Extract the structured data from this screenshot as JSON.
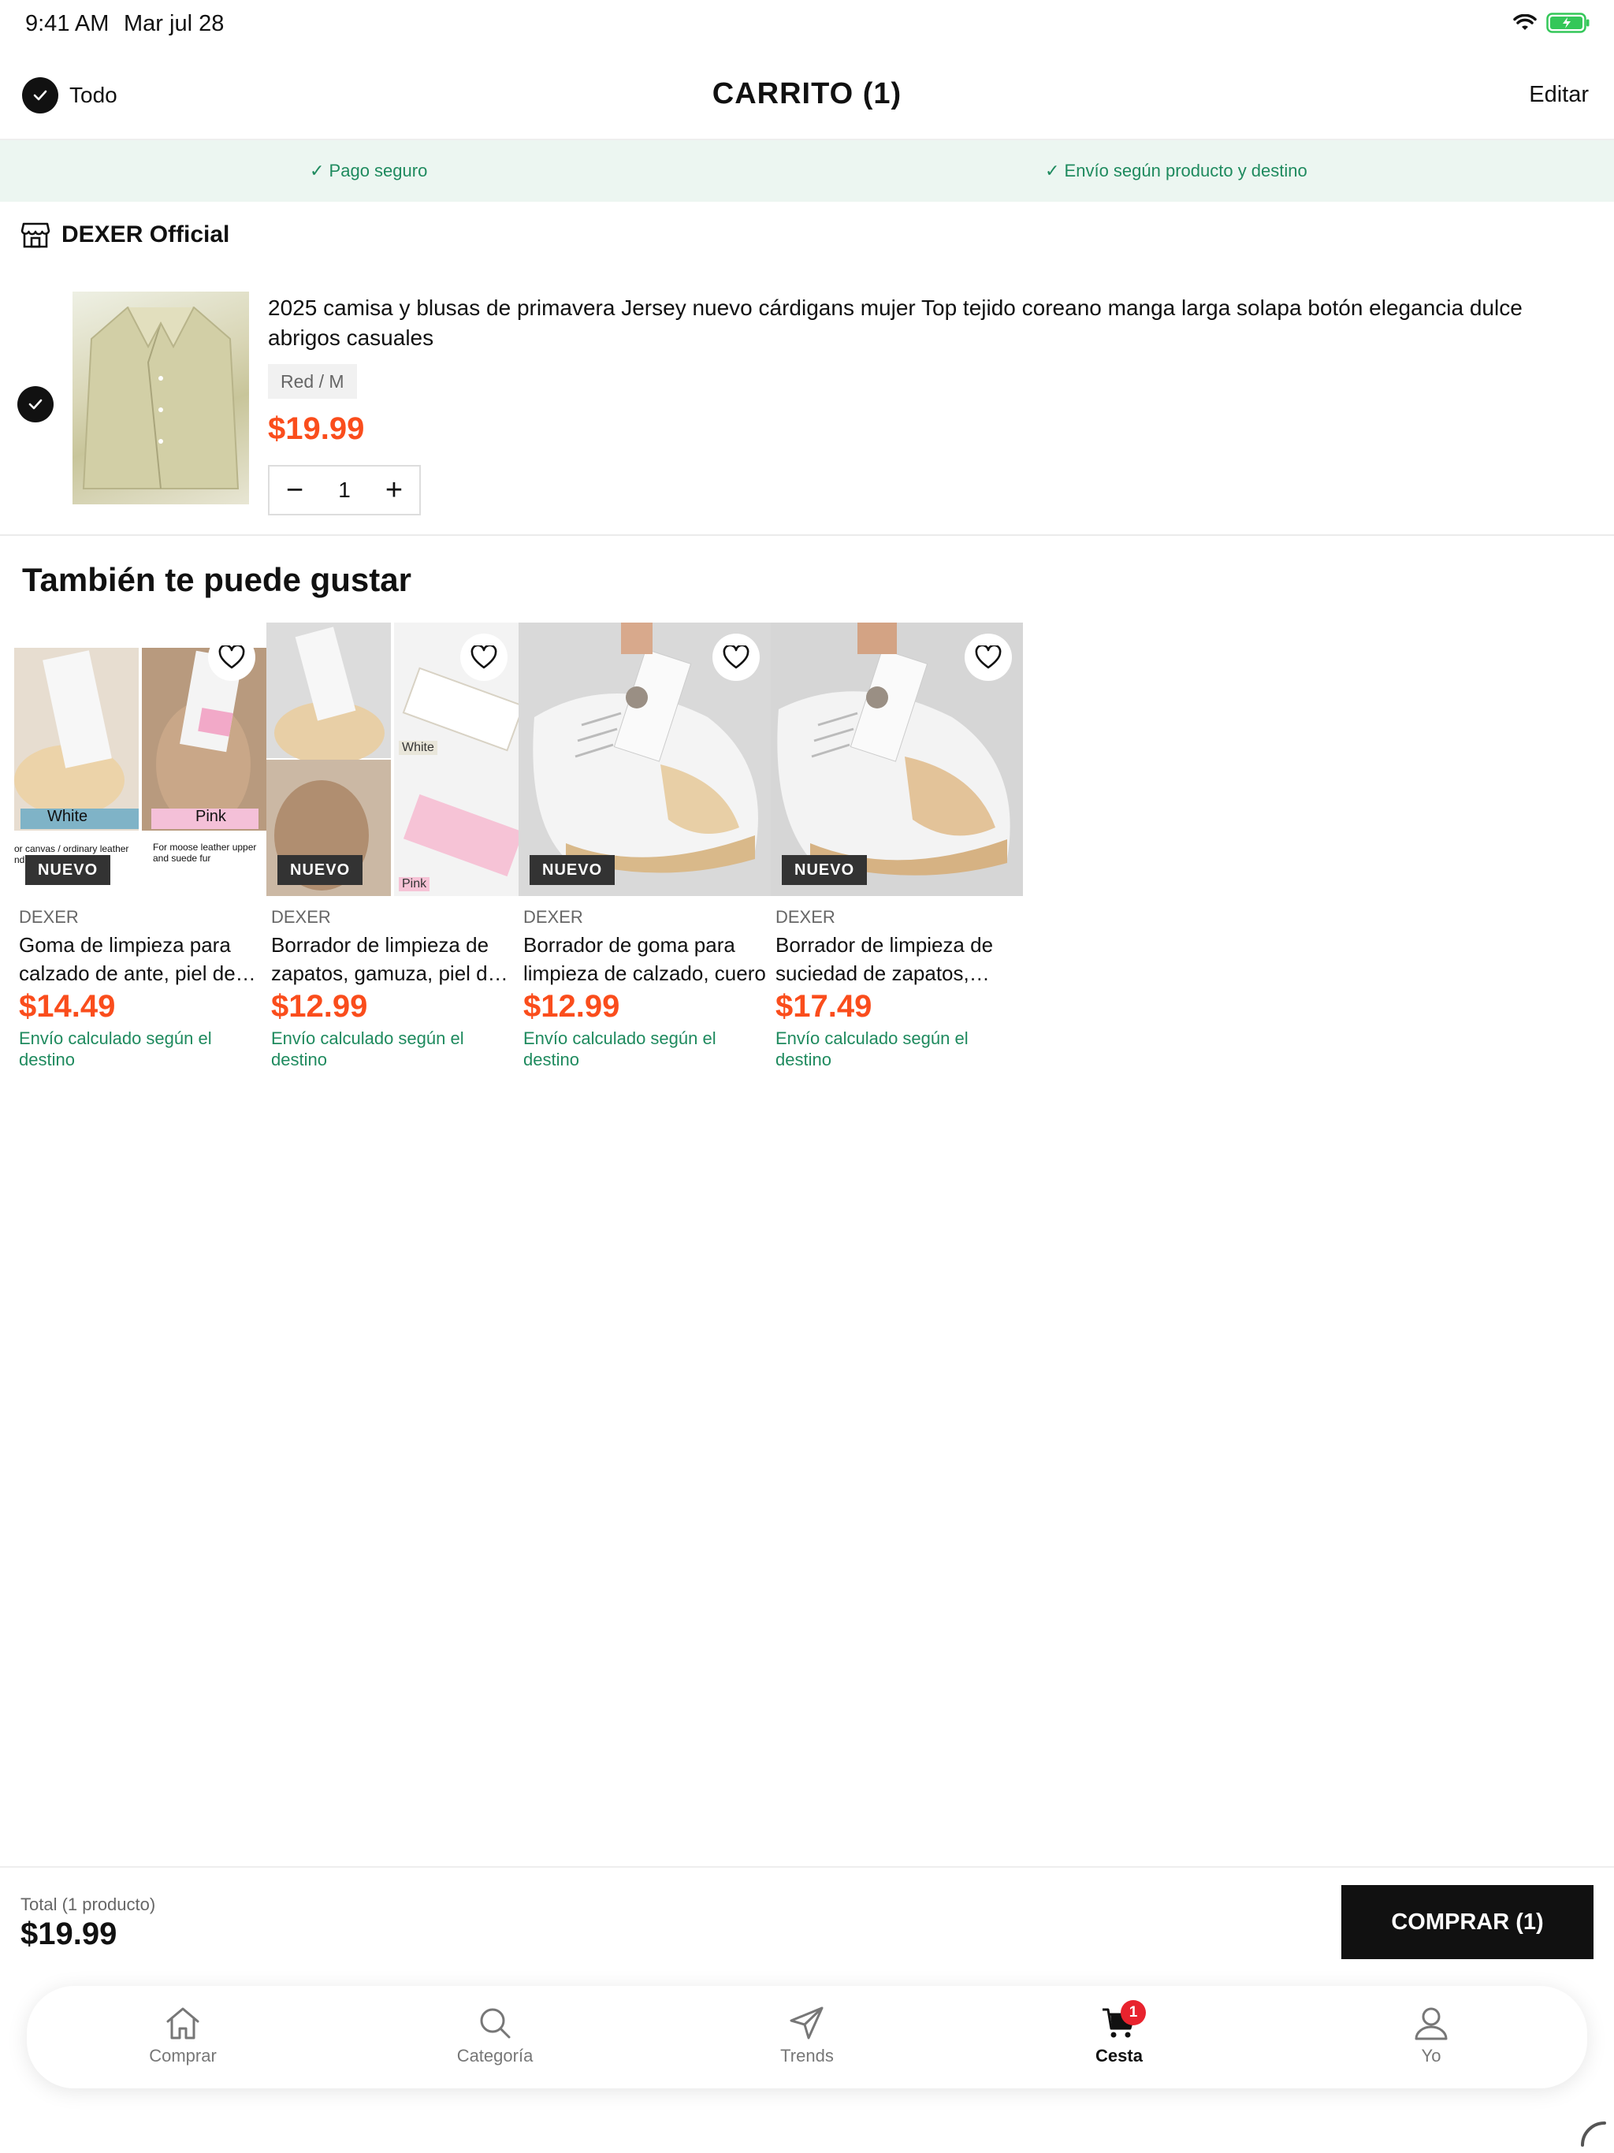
{
  "status_bar": {
    "time": "9:41 AM",
    "date": "Mar jul 28"
  },
  "header": {
    "select_all_label": "Todo",
    "title": "CARRITO (1)",
    "edit_label": "Editar"
  },
  "banner": {
    "items": [
      "✓ Pago seguro",
      "✓ Envío según producto y destino"
    ]
  },
  "store": {
    "name": "DEXER Official"
  },
  "cart_item": {
    "title": "2025 camisa y blusas de primavera Jersey nuevo cárdigans mujer Top tejido coreano manga larga solapa botón elegancia dulce abrigos casuales",
    "variant": "Red / M",
    "price": "$19.99",
    "quantity": "1",
    "minus": "−",
    "plus": "+"
  },
  "recommendations": {
    "title": "También te puede gustar",
    "badge": "NUEVO",
    "items": [
      {
        "brand": "DEXER",
        "name": "Goma de limpieza para calzado de ante, piel de cordero",
        "price": "$14.49",
        "shipping": "Envío calculado según el destino",
        "img_labels": [
          "White",
          "Pink"
        ],
        "img_captions": [
          "or canvas / ordinary leather nd rubber suede",
          "For moose leather upper and suede fur"
        ]
      },
      {
        "brand": "DEXER",
        "name": "Borrador de limpieza de zapatos, gamuza, piel de ante",
        "price": "$12.99",
        "shipping": "Envío calculado según el destino",
        "img_labels": [
          "White",
          "Pink"
        ]
      },
      {
        "brand": "DEXER",
        "name": "Borrador de goma para limpieza de calzado, cuero",
        "price": "$12.99",
        "shipping": "Envío calculado según el destino"
      },
      {
        "brand": "DEXER",
        "name": "Borrador de limpieza de suciedad de zapatos, limpiador",
        "price": "$17.49",
        "shipping": "Envío calculado según el destino"
      }
    ]
  },
  "checkout": {
    "total_label": "Total (1 producto)",
    "total_amount": "$19.99",
    "buy_label": "COMPRAR (1)"
  },
  "tabbar": {
    "tabs": [
      {
        "label": "Comprar",
        "icon": "home-icon"
      },
      {
        "label": "Categoría",
        "icon": "search-icon"
      },
      {
        "label": "Trends",
        "icon": "send-icon"
      },
      {
        "label": "Cesta",
        "icon": "cart-icon",
        "badge": "1",
        "active": true
      },
      {
        "label": "Yo",
        "icon": "user-icon"
      }
    ]
  },
  "colors": {
    "accent_price": "#fa4d1c",
    "green": "#1e8a5e",
    "badge_red": "#e8232e"
  }
}
